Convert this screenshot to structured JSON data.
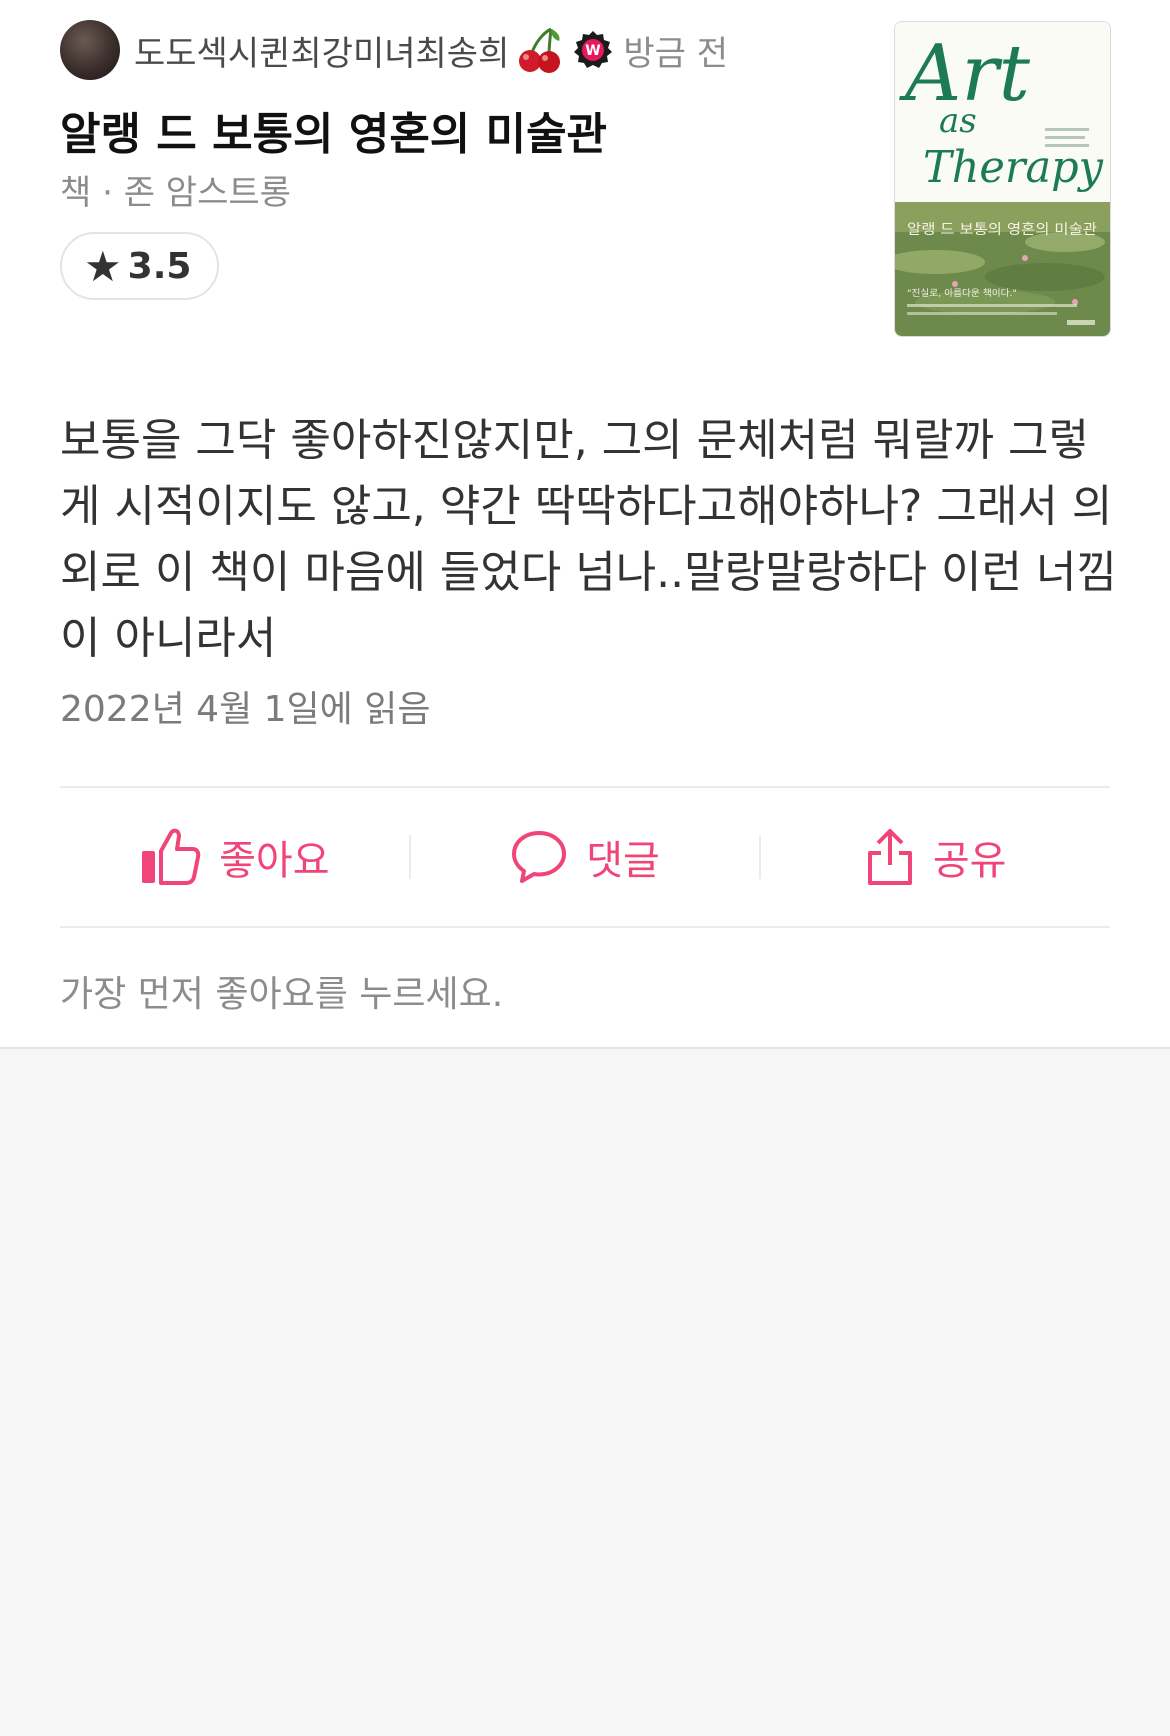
{
  "post": {
    "username": "도도섹시퀸최강미녀최송희",
    "time": "방금 전",
    "badge_letter": "W",
    "title": "알랭 드 보통의 영혼의 미술관",
    "meta": "책 · 존 암스트롱",
    "rating": "3.5",
    "body": "보통을 그닥 좋아하진않지만, 그의 문체처럼 뭐랄까 그렇게 시적이지도 않고, 약간 딱딱하다고해야하나? 그래서 의외로 이 책이 마음에 들었다 넘나..말랑말랑하다 이런 너낌이 아니라서",
    "read_date": "2022년 4월 1일에 읽음"
  },
  "cover": {
    "title_art": "Art",
    "title_as": "as",
    "title_therapy": "Therapy",
    "korean_title": "알랭 드 보통의 영혼의 미술관",
    "tagline": "\"진실로, 아름다운 책이다.\""
  },
  "actions": {
    "like_label": "좋아요",
    "comment_label": "댓글",
    "share_label": "공유"
  },
  "footer": {
    "first_like_text": "가장 먼저 좋아요를 누르세요."
  },
  "colors": {
    "accent": "#f1457a",
    "cherry_red": "#d11a2a",
    "badge_pink": "#e8185f"
  }
}
